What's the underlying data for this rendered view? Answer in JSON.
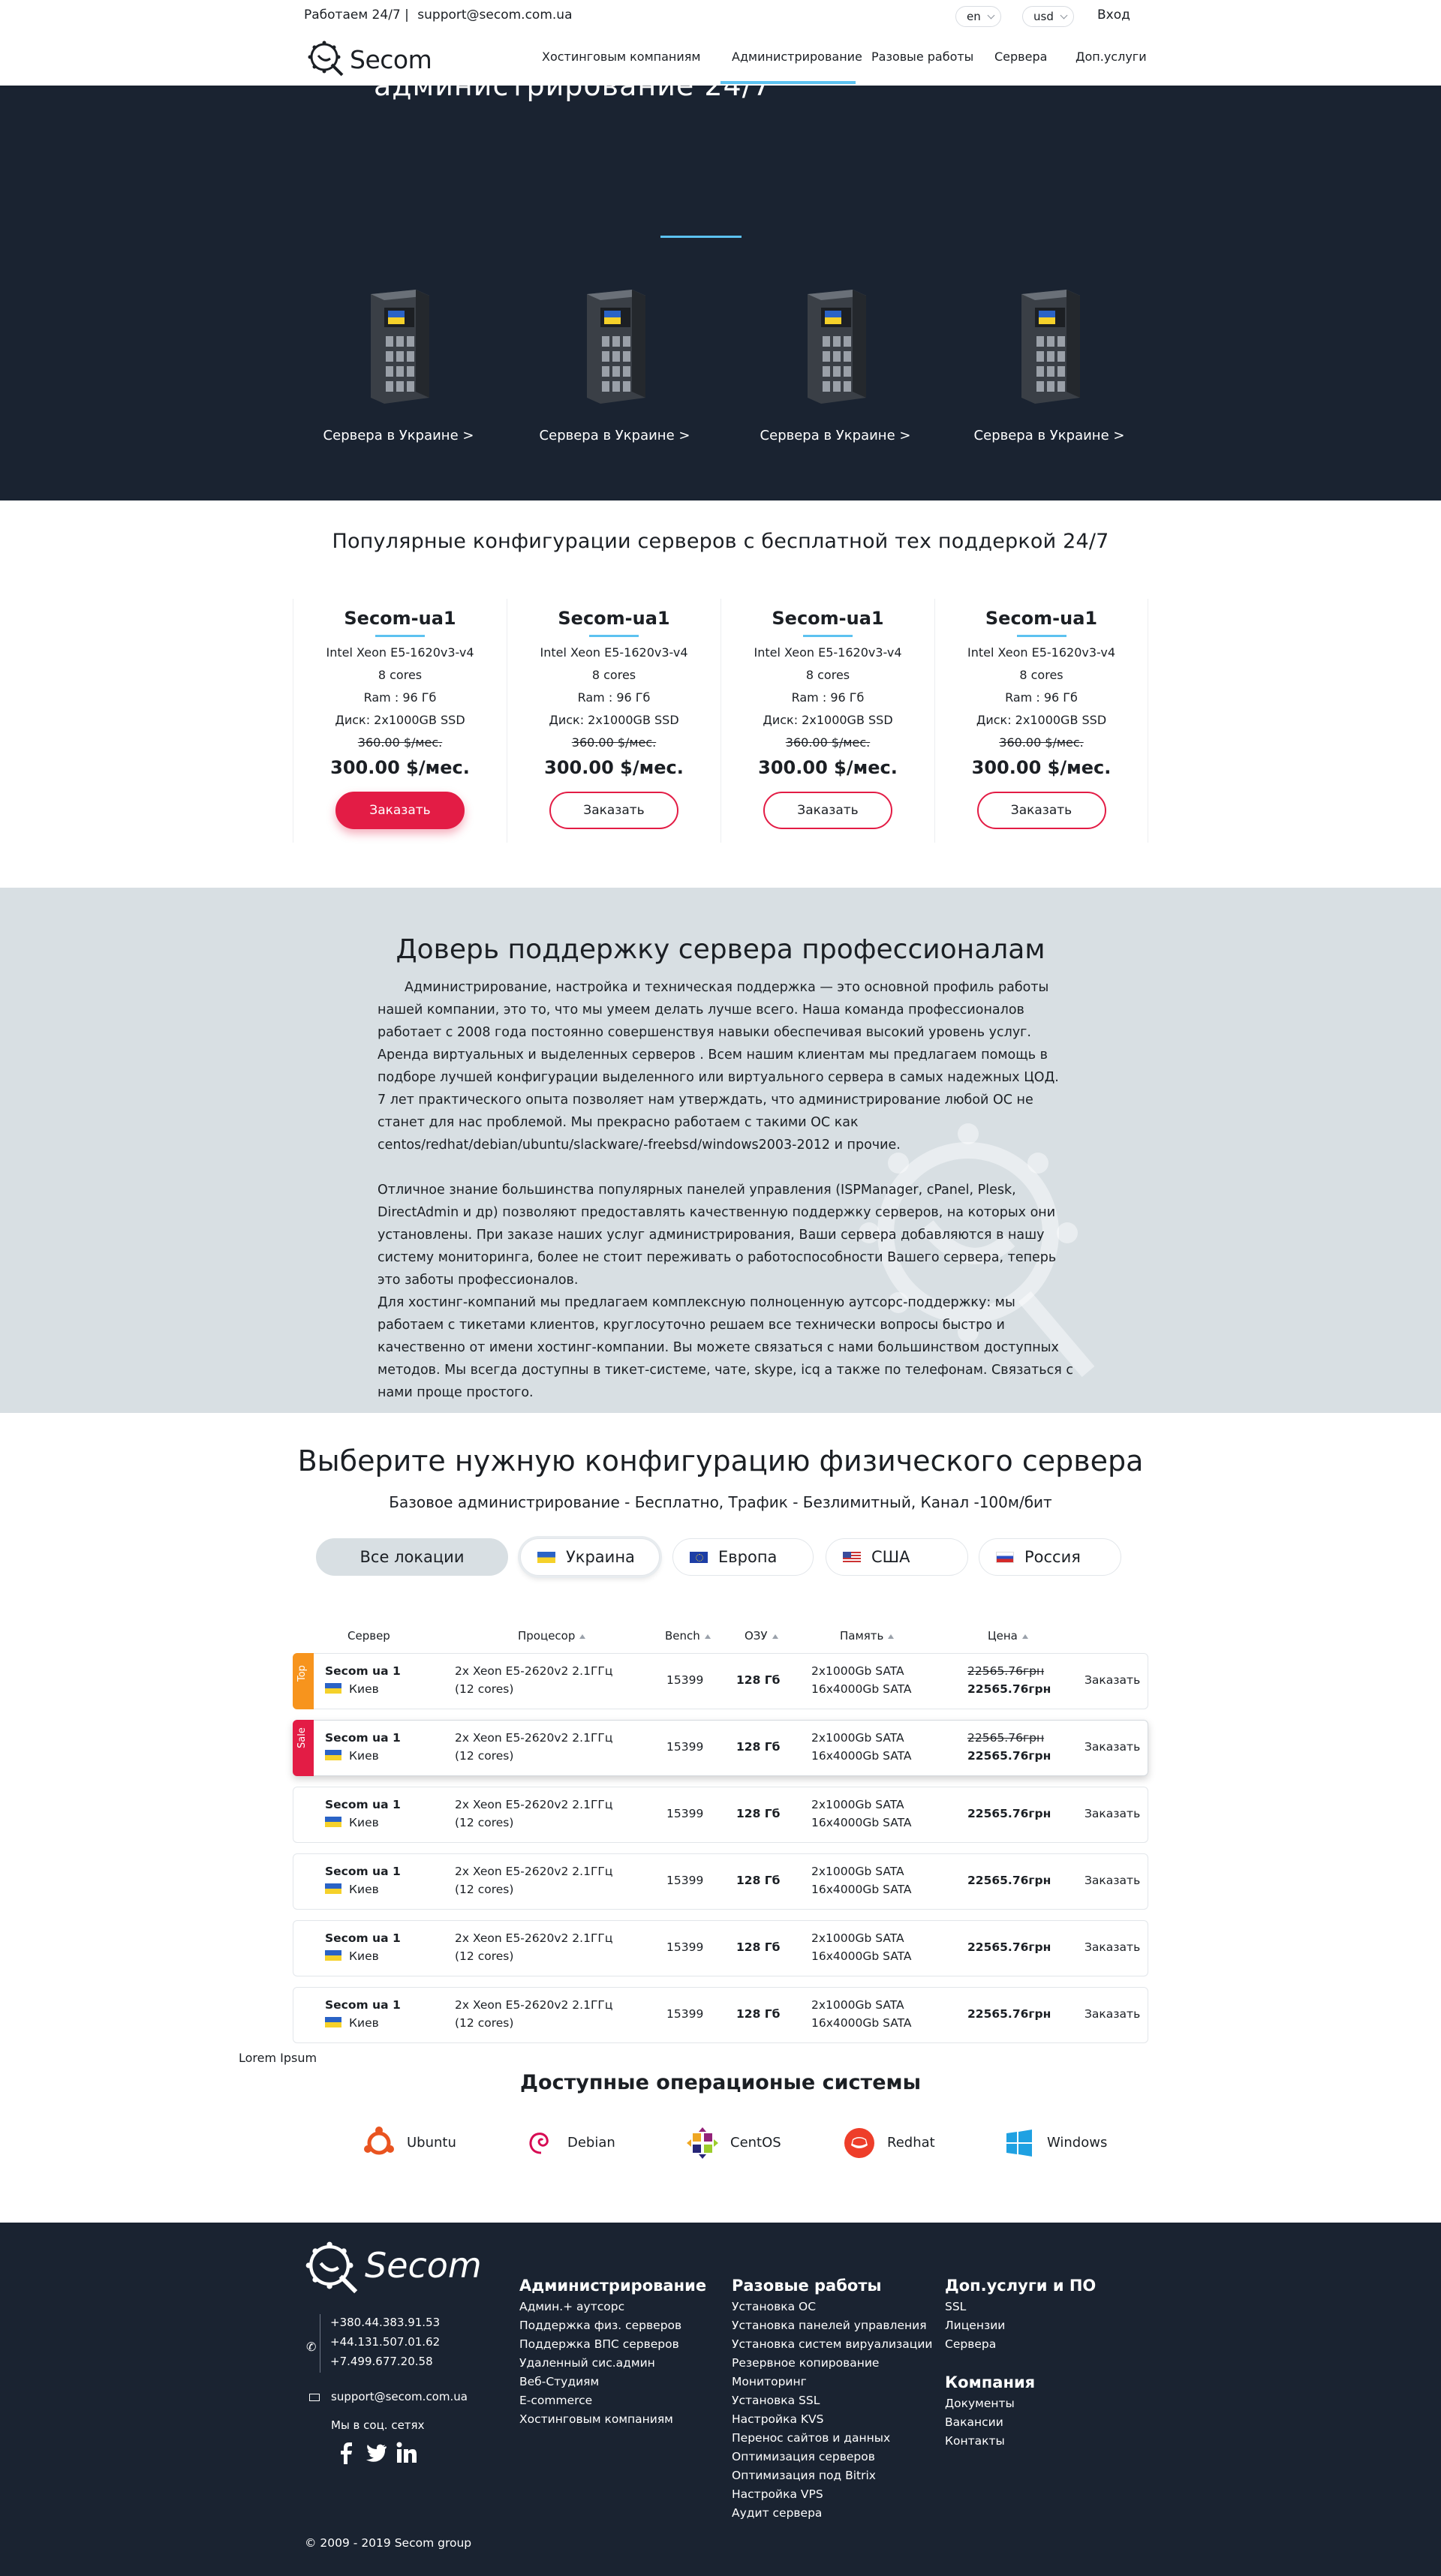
{
  "topbar": {
    "work_hours": "Работаем 24/7 |",
    "email": "support@secom.com.ua",
    "lang": "en",
    "currency": "usd",
    "login": "Вход"
  },
  "brand": {
    "name": "Secom"
  },
  "nav": {
    "items": [
      "Хостинговым компаниям",
      "Администрирование",
      "Разовые работы",
      "Сервера",
      "Доп.услуги"
    ],
    "active": "Администрирование"
  },
  "hero": {
    "cut_title": "администрирование 24/7",
    "servers": [
      {
        "label": "Сервера в Украине >"
      },
      {
        "label": "Сервера в Украине >"
      },
      {
        "label": "Сервера в Украине >"
      },
      {
        "label": "Сервера в Украине >"
      }
    ]
  },
  "configs": {
    "title": "Популярные конфигурации серверов с бесплатной тех поддеркой 24/7",
    "cards": [
      {
        "name": "Secom-ua1",
        "cpu": "Intel Xeon E5-1620v3-v4",
        "cores": "8 cores",
        "ram": "Ram : 96 Гб",
        "disk": "Диск: 2x1000GB SSD",
        "old_price": "360.00 $/мес.",
        "price": "300.00 $/мес.",
        "button": "Заказать"
      },
      {
        "name": "Secom-ua1",
        "cpu": "Intel Xeon E5-1620v3-v4",
        "cores": "8 cores",
        "ram": "Ram : 96 Гб",
        "disk": "Диск: 2x1000GB SSD",
        "old_price": "360.00 $/мес.",
        "price": "300.00 $/мес.",
        "button": "Заказать"
      },
      {
        "name": "Secom-ua1",
        "cpu": "Intel Xeon E5-1620v3-v4",
        "cores": "8 cores",
        "ram": "Ram : 96 Гб",
        "disk": "Диск: 2x1000GB SSD",
        "old_price": "360.00 $/мес.",
        "price": "300.00 $/мес.",
        "button": "Заказать"
      },
      {
        "name": "Secom-ua1",
        "cpu": "Intel Xeon E5-1620v3-v4",
        "cores": "8 cores",
        "ram": "Ram : 96 Гб",
        "disk": "Диск: 2x1000GB SSD",
        "old_price": "360.00 $/мес.",
        "price": "300.00 $/мес.",
        "button": "Заказать"
      }
    ]
  },
  "trust": {
    "title": "Доверь поддержку сервера профессионалам",
    "p1": "Администрирование, настройка и техническая поддержка — это основной профиль работы нашей компании, это то, что мы умеем делать лучше всего. Наша команда профессионалов работает с 2008 года постоянно совершенствуя навыки обеспечивая высокий уровень услуг. Аренда виртуальных и выделенных серверов . Всем нашим клиентам мы предлагаем помощь в подборе лучшей конфигурации выделенного или виртуального сервера в самых надежных ЦОД.",
    "p2": "7 лет практического опыта позволяет нам утверждать, что администрирование любой ОС не станет для нас проблемой. Мы прекрасно работаем с такими ОС как centos/redhat/debian/ubuntu/slackware/-freebsd/windows2003-2012 и прочие.",
    "p3": "Отличное знание большинства популярных панелей управления (ISPManager, cPanel, Plesk, DirectAdmin и др) позволяют предоставлять качественную поддержку серверов, на которых они установлены. При заказе наших услуг администрирования, Ваши сервера добавляются в нашу систему мониторинга, более не стоит переживать о работоспособности Вашего сервера, теперь это заботы профессионалов.",
    "p4": "Для хостинг-компаний мы предлагаем комплексную полноценную аутсорс-поддержку: мы работаем с тикетами клиентов, круглосуточно решаем все технически вопросы быстро и качественно от имени хостинг-компании. Вы можете связаться с нами большинством доступных методов. Мы всегда доступны в тикет-системе, чате, skype, icq а также по телефонам. Связаться с нами проще простого."
  },
  "choose": {
    "title": "Выберите нужную конфигурацию физического сервера",
    "subtitle": "Базовое администрирование - Бесплатно, Трафик - Безлимитный, Канал -100м/бит",
    "locations": [
      "Все локации",
      "Украина",
      "Европа",
      "США",
      "Россия"
    ],
    "columns": [
      "Сервер",
      "Процесор",
      "Bench",
      "ОЗУ",
      "Память",
      "Цена"
    ],
    "rows": [
      {
        "tag": "Top",
        "name": "Secom ua 1",
        "city": "Киев",
        "cpu1": "2x Xeon E5-2620v2 2.1ГГц",
        "cpu2": "(12 cores)",
        "bench": "15399",
        "ram": "128 Гб",
        "disk1": "2x1000Gb SATA",
        "disk2": "16x4000Gb SATA",
        "old_price": "22565.76грн",
        "price": "22565.76грн",
        "order": "Заказать"
      },
      {
        "tag": "Sale",
        "name": "Secom ua 1",
        "city": "Киев",
        "cpu1": "2x Xeon E5-2620v2 2.1ГГц",
        "cpu2": "(12 cores)",
        "bench": "15399",
        "ram": "128 Гб",
        "disk1": "2x1000Gb SATA",
        "disk2": "16x4000Gb SATA",
        "old_price": "22565.76грн",
        "price": "22565.76грн",
        "order": "Заказать"
      },
      {
        "tag": "",
        "name": "Secom ua 1",
        "city": "Киев",
        "cpu1": "2x Xeon E5-2620v2 2.1ГГц",
        "cpu2": "(12 cores)",
        "bench": "15399",
        "ram": "128 Гб",
        "disk1": "2x1000Gb SATA",
        "disk2": "16x4000Gb SATA",
        "old_price": "",
        "price": "22565.76грн",
        "order": "Заказать"
      },
      {
        "tag": "",
        "name": "Secom ua 1",
        "city": "Киев",
        "cpu1": "2x Xeon E5-2620v2 2.1ГГц",
        "cpu2": "(12 cores)",
        "bench": "15399",
        "ram": "128 Гб",
        "disk1": "2x1000Gb SATA",
        "disk2": "16x4000Gb SATA",
        "old_price": "",
        "price": "22565.76грн",
        "order": "Заказать"
      },
      {
        "tag": "",
        "name": "Secom ua 1",
        "city": "Киев",
        "cpu1": "2x Xeon E5-2620v2 2.1ГГц",
        "cpu2": "(12 cores)",
        "bench": "15399",
        "ram": "128 Гб",
        "disk1": "2x1000Gb SATA",
        "disk2": "16x4000Gb SATA",
        "old_price": "",
        "price": "22565.76грн",
        "order": "Заказать"
      },
      {
        "tag": "",
        "name": "Secom ua 1",
        "city": "Киев",
        "cpu1": "2x Xeon E5-2620v2 2.1ГГц",
        "cpu2": "(12 cores)",
        "bench": "15399",
        "ram": "128 Гб",
        "disk1": "2x1000Gb SATA",
        "disk2": "16x4000Gb SATA",
        "old_price": "",
        "price": "22565.76грн",
        "order": "Заказать"
      }
    ]
  },
  "lorem": "Lorem Ipsum",
  "os": {
    "title": "Доступные операционые системы",
    "items": [
      {
        "name": "Ubuntu",
        "icon": "ubuntu-icon",
        "color": "#e95420"
      },
      {
        "name": "Debian",
        "icon": "debian-icon",
        "color": "#d70a53"
      },
      {
        "name": "CentOS",
        "icon": "centos-icon",
        "color": "#932279"
      },
      {
        "name": "Redhat",
        "icon": "redhat-icon",
        "color": "#ee3e2a"
      },
      {
        "name": "Windows",
        "icon": "windows-icon",
        "color": "#1fa1e2"
      }
    ]
  },
  "footer": {
    "phones": [
      "+380.44.383.91.53",
      "+44.131.507.01.62",
      "+7.499.677.20.58"
    ],
    "email": "support@secom.com.ua",
    "social_label": "Мы в соц. сетях",
    "social": [
      "facebook-icon",
      "twitter-icon",
      "linkedin-icon"
    ],
    "col_admin": {
      "title": "Администрирование",
      "items": [
        "Админ.+ аутсорс",
        "Поддержка физ. серверов",
        "Поддержка ВПС серверов",
        "Удаленный сис.админ",
        "Веб-Студиям",
        "E-commerce",
        "Хостинговым компаниям"
      ]
    },
    "col_works": {
      "title": "Разовые работы",
      "items": [
        "Установка ОС",
        "Установка панелей управления",
        "Установка систем вируализации",
        "Резервное копирование",
        "Мониторинг",
        "Установка SSL",
        "Настройка KVS",
        "Перенос сайтов и данных",
        "Оптимизация серверов",
        "Оптимизация под Bitrix",
        "Настройка VPS",
        "Аудит сервера"
      ]
    },
    "col_extra": {
      "title": "Доп.услуги и ПО",
      "items": [
        "SSL",
        "Лицензии",
        "Сервера"
      ]
    },
    "col_company": {
      "title": "Компания",
      "items": [
        "Документы",
        "Вакансии",
        "Контакты"
      ]
    },
    "copyright": "© 2009 - 2019 Secom group"
  },
  "colors": {
    "accent": "#5cc2f0",
    "brand_red": "#e31c45",
    "dark": "#1a2331",
    "grey_band": "#d8dfe3",
    "tag_top": "#f7941d"
  }
}
